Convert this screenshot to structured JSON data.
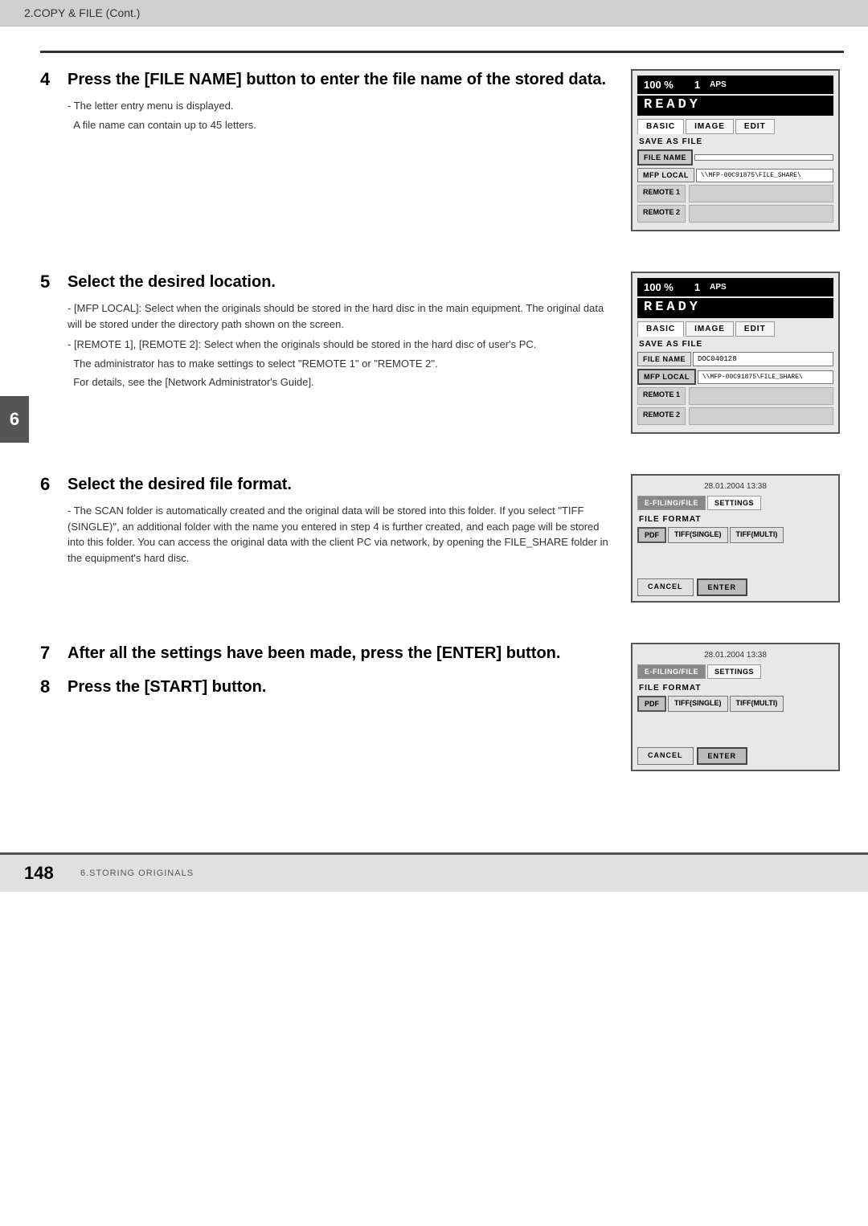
{
  "header": {
    "title": "2.COPY & FILE (Cont.)"
  },
  "footer": {
    "page_number": "148",
    "section": "6.STORING ORIGINALS"
  },
  "side_tab": "6",
  "steps": [
    {
      "number": "4",
      "title": "Press the [FILE NAME] button to enter the file name of the stored data.",
      "body": [
        "- The letter entry menu is displayed.",
        "  A file name can contain up to 45 letters."
      ]
    },
    {
      "number": "5",
      "title": "Select the desired location.",
      "body": [
        "- [MFP LOCAL]: Select when the originals should be stored in the hard disc in the main equipment. The original data will be stored under the directory path shown on the screen.",
        "- [REMOTE 1], [REMOTE 2]: Select when the originals should be stored in the hard disc of user's PC.",
        "  The administrator has to make settings to select \"REMOTE 1\" or \"REMOTE 2\".",
        "  For details, see the [Network Administrator's Guide]."
      ]
    },
    {
      "number": "6",
      "title": "Select the desired file format.",
      "body": [
        "- The SCAN folder is automatically created and the original data will be stored into this folder. If you select \"TIFF (SINGLE)\", an additional folder with the name you entered in step 4 is further created, and each page will be stored into this folder. You can access the original data with the client PC via network, by opening the FILE_SHARE folder in the equipment's hard disc."
      ]
    },
    {
      "number": "7",
      "title": "After all the settings have been made, press the [ENTER] button.",
      "body": []
    },
    {
      "number": "8",
      "title": "Press the [START] button.",
      "body": []
    }
  ],
  "screens": {
    "screen4": {
      "percent": "100 %",
      "copies": "1",
      "aps": "APS",
      "ready": "READY",
      "tabs": [
        "BASIC",
        "IMAGE",
        "EDIT"
      ],
      "active_tab": "BASIC",
      "save_label": "SAVE AS FILE",
      "file_name_btn": "FILE NAME",
      "file_name_value": "",
      "mfp_local_btn": "MFP LOCAL",
      "mfp_local_value": "\\\\MFP-00C91875\\FILE_SHARE\\",
      "remote1_btn": "REMOTE 1",
      "remote1_value": "",
      "remote2_btn": "REMOTE 2",
      "remote2_value": ""
    },
    "screen5": {
      "percent": "100 %",
      "copies": "1",
      "aps": "APS",
      "ready": "READY",
      "tabs": [
        "BASIC",
        "IMAGE",
        "EDIT"
      ],
      "active_tab": "BASIC",
      "save_label": "SAVE AS FILE",
      "file_name_btn": "FILE NAME",
      "file_name_value": "DOC040128",
      "mfp_local_btn": "MFP LOCAL",
      "mfp_local_value": "\\\\MFP-00C91875\\FILE_SHARE\\",
      "remote1_btn": "REMOTE 1",
      "remote1_value": "",
      "remote2_btn": "REMOTE 2",
      "remote2_value": ""
    },
    "screen6": {
      "datetime": "28.01.2004  13:38",
      "tab1": "E-FILING/FILE",
      "tab2": "SETTINGS",
      "file_format_label": "FILE FORMAT",
      "format_pdf": "PDF",
      "format_tiff_single": "TIFF(SINGLE)",
      "format_tiff_multi": "TIFF(MULTI)",
      "cancel_btn": "CANCEL",
      "enter_btn": "ENTER"
    },
    "screen7_8": {
      "datetime": "28.01.2004  13:38",
      "tab1": "E-FILING/FILE",
      "tab2": "SETTINGS",
      "file_format_label": "FILE FORMAT",
      "format_pdf": "PDF",
      "format_tiff_single": "TIFF(SINGLE)",
      "format_tiff_multi": "TIFF(MULTI)",
      "cancel_btn": "CANCEL",
      "enter_btn": "ENTER"
    }
  }
}
